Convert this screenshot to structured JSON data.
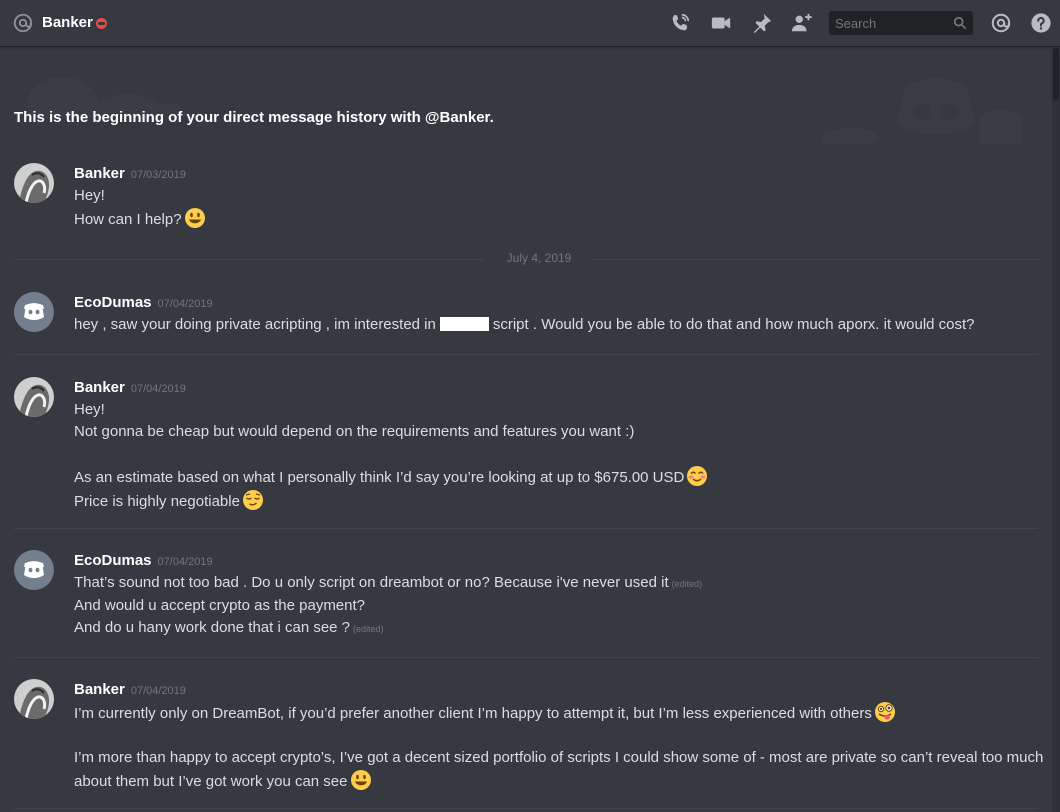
{
  "header": {
    "channel_name": "Banker",
    "search_placeholder": "Search",
    "icons": [
      "at-icon",
      "dnd-status-icon",
      "call-icon",
      "video-call-icon",
      "pin-icon",
      "add-friend-icon",
      "search-icon",
      "mention-icon",
      "help-icon"
    ]
  },
  "colors": {
    "background": "#36393f",
    "header_border": "#202225",
    "username": "#ffffff",
    "timestamp": "#72767d",
    "text": "#dcddde",
    "dnd_status": "#f04747",
    "discord_blurple": "#7289da"
  },
  "intro": {
    "prefix": "This is the beginning of your direct message history with ",
    "mention": "@Banker",
    "suffix": "."
  },
  "date_divider": "July 4, 2019",
  "messages": [
    {
      "author": "Banker",
      "timestamp": "07/03/2019",
      "avatar": "banker-avatar",
      "lines": [
        "Hey!",
        "How can I help?"
      ]
    },
    {
      "author": "EcoDumas",
      "timestamp": "07/04/2019",
      "avatar": "discord-default-avatar",
      "line_a": "hey , saw your doing private acripting , im interested in",
      "line_b": "script . Would you be able to do that and how much aporx. it would cost?"
    },
    {
      "author": "Banker",
      "timestamp": "07/04/2019",
      "avatar": "banker-avatar",
      "lines": [
        "Hey!",
        "Not gonna be cheap but would depend on the requirements and features you want :)",
        "As an estimate based on what I personally think I’d say you’re looking at up to $675.00 USD",
        "Price is highly negotiable"
      ]
    },
    {
      "author": "EcoDumas",
      "timestamp": "07/04/2019",
      "avatar": "discord-default-avatar",
      "lines": [
        "That’s sound not too bad . Do u only script on dreambot or no? Because i've never used it",
        "And would u accept crypto as the payment?",
        "And do u hany work done that i can see ?"
      ],
      "edited_label": "(edited)"
    },
    {
      "author": "Banker",
      "timestamp": "07/04/2019",
      "avatar": "banker-avatar",
      "lines": [
        "I’m currently only on DreamBot, if you’d prefer another client I’m happy to attempt it, but I’m less experienced with others",
        "I’m more than happy to accept crypto’s, I’ve got a decent sized portfolio of scripts I could show some of - most are private so can’t reveal too much about them but I’ve got work you can see"
      ]
    }
  ]
}
